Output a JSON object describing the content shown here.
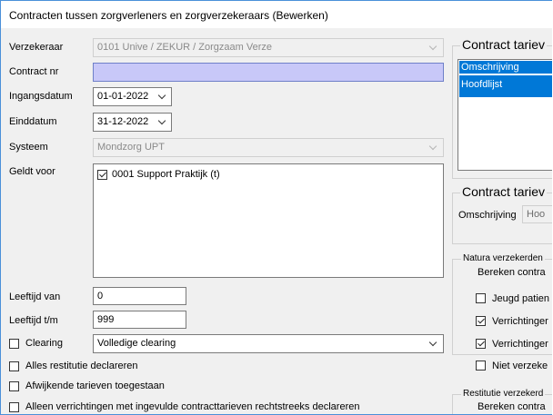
{
  "window": {
    "title": "Contracten tussen zorgverleners en zorgverzekeraars (Bewerken)"
  },
  "form": {
    "verzekeraar": {
      "label": "Verzekeraar",
      "value": "0101 Unive / ZEKUR / Zorgzaam Verze"
    },
    "contract_nr": {
      "label": "Contract nr",
      "value": ""
    },
    "ingangsdatum": {
      "label": "Ingangsdatum",
      "value": "01-01-2022"
    },
    "einddatum": {
      "label": "Einddatum",
      "value": "31-12-2022"
    },
    "systeem": {
      "label": "Systeem",
      "value": "Mondzorg UPT"
    },
    "geldt_voor": {
      "label": "Geldt voor",
      "items": [
        {
          "label": "0001 Support Praktijk (t)",
          "checked": true
        }
      ]
    },
    "leeftijd_van": {
      "label": "Leeftijd van",
      "value": "0"
    },
    "leeftijd_tm": {
      "label": "Leeftijd t/m",
      "value": "999"
    },
    "clearing": {
      "label": "Clearing",
      "checked": false,
      "value": "Volledige clearing"
    },
    "alles_restitutie": {
      "label": "Alles restitutie declareren",
      "checked": false
    },
    "afwijkende_tarieven": {
      "label": "Afwijkende tarieven toegestaan",
      "checked": false
    },
    "alleen_verrichtingen": {
      "label": "Alleen verrichtingen met ingevulde contracttarieven rechtstreeks declareren",
      "checked": false
    }
  },
  "right": {
    "group1": {
      "title": "Contract tariev",
      "list_header": "Omschrijving",
      "list_items": [
        "Hoofdlijst"
      ]
    },
    "group2": {
      "title": "Contract tariev",
      "omschrijving_label": "Omschrijving",
      "omschrijving_value": "Hoo"
    },
    "natura": {
      "title": "Natura verzekerden",
      "subtitle": "Bereken contra",
      "items": [
        {
          "label": "Jeugd patien",
          "checked": false
        },
        {
          "label": "Verrichtinger",
          "checked": true
        },
        {
          "label": "Verrichtinger",
          "checked": true
        },
        {
          "label": "Niet verzeke",
          "checked": false
        }
      ]
    },
    "restitutie": {
      "title": "Restitutie verzekerd",
      "subtitle": "Bereken contra"
    }
  }
}
